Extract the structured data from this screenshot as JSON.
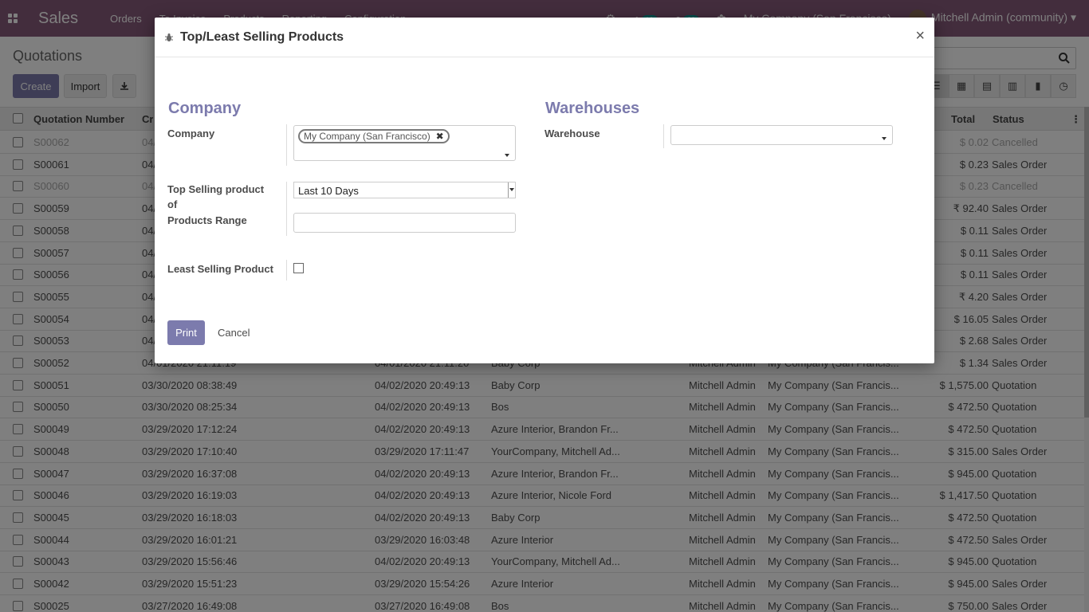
{
  "navbar": {
    "app_name": "Sales",
    "menu": [
      "Orders",
      "To Invoice",
      "Products",
      "Reporting",
      "Configuration"
    ],
    "activity_count": "13",
    "messages_count": "22",
    "company": "My Company (San Francisco)",
    "user": "Mitchell Admin (community)"
  },
  "control_panel": {
    "title": "Quotations",
    "create_label": "Create",
    "import_label": "Import"
  },
  "list": {
    "columns": [
      "Quotation Number",
      "Cr",
      "Total",
      "Status"
    ],
    "rows": [
      {
        "number": "S00062",
        "created": "04/",
        "expected": "",
        "customer": "",
        "salesperson": "",
        "company": "",
        "total": "$ 0.02",
        "status": "Cancelled",
        "cancelled": true
      },
      {
        "number": "S00061",
        "created": "04/",
        "expected": "",
        "customer": "",
        "salesperson": "",
        "company": "",
        "total": "$ 0.23",
        "status": "Sales Order",
        "cancelled": false
      },
      {
        "number": "S00060",
        "created": "04/",
        "expected": "",
        "customer": "",
        "salesperson": "",
        "company": "",
        "total": "$ 0.23",
        "status": "Cancelled",
        "cancelled": true
      },
      {
        "number": "S00059",
        "created": "04/",
        "expected": "",
        "customer": "",
        "salesperson": "",
        "company": "",
        "total": "₹ 92.40",
        "status": "Sales Order",
        "cancelled": false
      },
      {
        "number": "S00058",
        "created": "04/",
        "expected": "",
        "customer": "",
        "salesperson": "",
        "company": "",
        "total": "$ 0.11",
        "status": "Sales Order",
        "cancelled": false
      },
      {
        "number": "S00057",
        "created": "04/",
        "expected": "",
        "customer": "",
        "salesperson": "",
        "company": "",
        "total": "$ 0.11",
        "status": "Sales Order",
        "cancelled": false
      },
      {
        "number": "S00056",
        "created": "04/",
        "expected": "",
        "customer": "",
        "salesperson": "",
        "company": "",
        "total": "$ 0.11",
        "status": "Sales Order",
        "cancelled": false
      },
      {
        "number": "S00055",
        "created": "04/",
        "expected": "",
        "customer": "",
        "salesperson": "",
        "company": "",
        "total": "₹ 4.20",
        "status": "Sales Order",
        "cancelled": false
      },
      {
        "number": "S00054",
        "created": "04/",
        "expected": "",
        "customer": "",
        "salesperson": "",
        "company": "",
        "total": "$ 16.05",
        "status": "Sales Order",
        "cancelled": false
      },
      {
        "number": "S00053",
        "created": "04/",
        "expected": "",
        "customer": "",
        "salesperson": "",
        "company": "",
        "total": "$ 2.68",
        "status": "Sales Order",
        "cancelled": false
      },
      {
        "number": "S00052",
        "created": "04/01/2020 21:11:19",
        "expected": "04/01/2020 21:11:20",
        "customer": "Baby Corp",
        "salesperson": "Mitchell Admin",
        "company": "My Company (San Francis...",
        "total": "$ 1.34",
        "status": "Sales Order",
        "cancelled": false
      },
      {
        "number": "S00051",
        "created": "03/30/2020 08:38:49",
        "expected": "04/02/2020 20:49:13",
        "customer": "Baby Corp",
        "salesperson": "Mitchell Admin",
        "company": "My Company (San Francis...",
        "total": "$ 1,575.00",
        "status": "Quotation",
        "cancelled": false
      },
      {
        "number": "S00050",
        "created": "03/30/2020 08:25:34",
        "expected": "04/02/2020 20:49:13",
        "customer": "Bos",
        "salesperson": "Mitchell Admin",
        "company": "My Company (San Francis...",
        "total": "$ 472.50",
        "status": "Quotation",
        "cancelled": false
      },
      {
        "number": "S00049",
        "created": "03/29/2020 17:12:24",
        "expected": "04/02/2020 20:49:13",
        "customer": "Azure Interior, Brandon Fr...",
        "salesperson": "Mitchell Admin",
        "company": "My Company (San Francis...",
        "total": "$ 472.50",
        "status": "Quotation",
        "cancelled": false
      },
      {
        "number": "S00048",
        "created": "03/29/2020 17:10:40",
        "expected": "03/29/2020 17:11:47",
        "customer": "YourCompany, Mitchell Ad...",
        "salesperson": "Mitchell Admin",
        "company": "My Company (San Francis...",
        "total": "$ 315.00",
        "status": "Sales Order",
        "cancelled": false
      },
      {
        "number": "S00047",
        "created": "03/29/2020 16:37:08",
        "expected": "04/02/2020 20:49:13",
        "customer": "Azure Interior, Brandon Fr...",
        "salesperson": "Mitchell Admin",
        "company": "My Company (San Francis...",
        "total": "$ 945.00",
        "status": "Quotation",
        "cancelled": false
      },
      {
        "number": "S00046",
        "created": "03/29/2020 16:19:03",
        "expected": "04/02/2020 20:49:13",
        "customer": "Azure Interior, Nicole Ford",
        "salesperson": "Mitchell Admin",
        "company": "My Company (San Francis...",
        "total": "$ 1,417.50",
        "status": "Quotation",
        "cancelled": false
      },
      {
        "number": "S00045",
        "created": "03/29/2020 16:18:03",
        "expected": "04/02/2020 20:49:13",
        "customer": "Baby Corp",
        "salesperson": "Mitchell Admin",
        "company": "My Company (San Francis...",
        "total": "$ 472.50",
        "status": "Quotation",
        "cancelled": false
      },
      {
        "number": "S00044",
        "created": "03/29/2020 16:01:21",
        "expected": "03/29/2020 16:03:48",
        "customer": "Azure Interior",
        "salesperson": "Mitchell Admin",
        "company": "My Company (San Francis...",
        "total": "$ 472.50",
        "status": "Sales Order",
        "cancelled": false
      },
      {
        "number": "S00043",
        "created": "03/29/2020 15:56:46",
        "expected": "04/02/2020 20:49:13",
        "customer": "YourCompany, Mitchell Ad...",
        "salesperson": "Mitchell Admin",
        "company": "My Company (San Francis...",
        "total": "$ 945.00",
        "status": "Quotation",
        "cancelled": false
      },
      {
        "number": "S00042",
        "created": "03/29/2020 15:51:23",
        "expected": "03/29/2020 15:54:26",
        "customer": "Azure Interior",
        "salesperson": "Mitchell Admin",
        "company": "My Company (San Francis...",
        "total": "$ 945.00",
        "status": "Sales Order",
        "cancelled": false
      },
      {
        "number": "S00025",
        "created": "03/27/2020 16:49:08",
        "expected": "03/27/2020 16:49:08",
        "customer": "Bos",
        "salesperson": "Mitchell Admin",
        "company": "My Company (San Francis...",
        "total": "$ 750.00",
        "status": "Sales Order",
        "cancelled": false
      }
    ]
  },
  "modal": {
    "title": "Top/Least Selling Products",
    "close_symbol": "×",
    "company_section": "Company",
    "company_label": "Company",
    "company_tag": "My Company (San Francisco)",
    "top_selling_label_line1": "Top Selling product",
    "top_selling_label_line2": "of",
    "top_selling_value": "Last 10 Days",
    "products_range_label": "Products Range",
    "products_range_value": "",
    "least_selling_label": "Least Selling Product",
    "least_selling_checked": false,
    "warehouses_section": "Warehouses",
    "warehouse_label": "Warehouse",
    "warehouse_value": "",
    "print_label": "Print",
    "cancel_label": "Cancel"
  },
  "colors": {
    "navbar": "#875a7b",
    "primary": "#7c7bad"
  }
}
